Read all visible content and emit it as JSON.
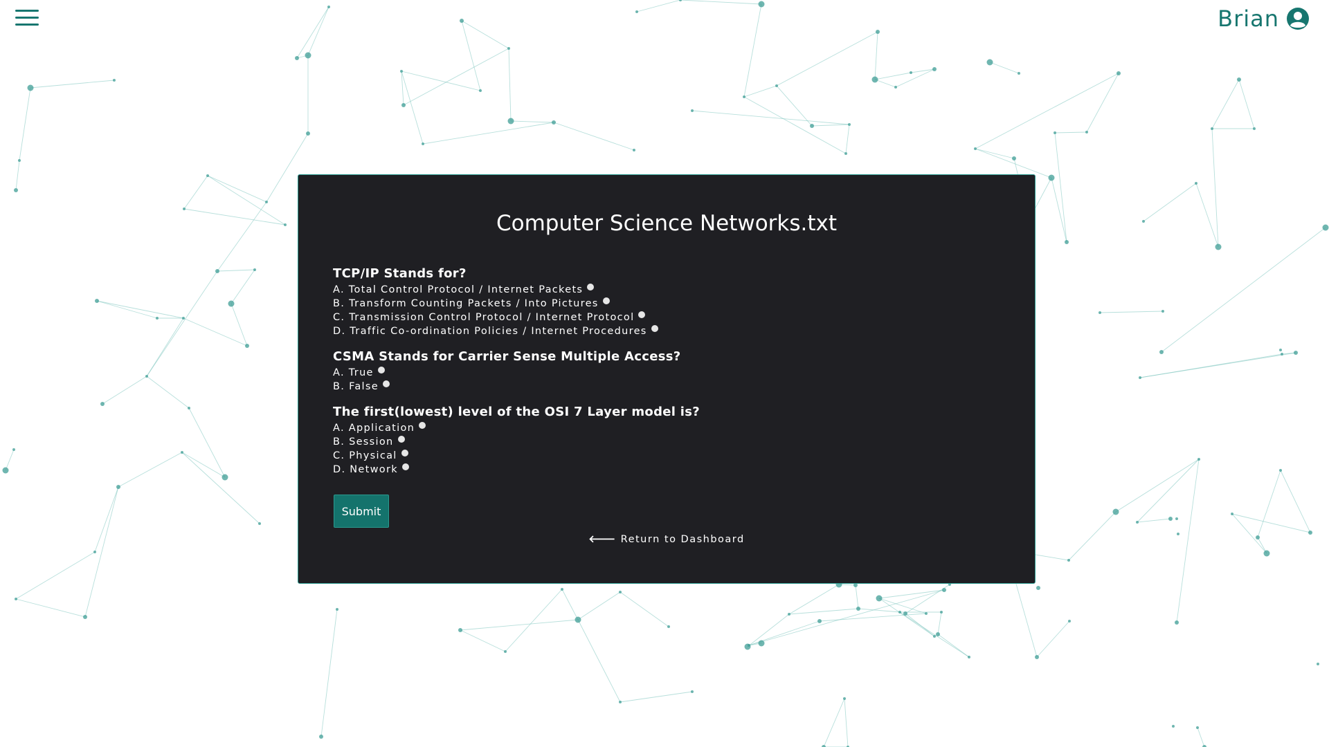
{
  "header": {
    "menu_icon": "hamburger-menu-icon",
    "user_name": "Brian",
    "user_icon": "user-circle-icon",
    "accent_color": "#17766f"
  },
  "quiz": {
    "title": "Computer Science Networks.txt",
    "questions": [
      {
        "text": "TCP/IP Stands for?",
        "options": [
          "A. Total Control Protocol / Internet Packets",
          "B. Transform Counting Packets / Into Pictures",
          "C. Transmission Control Protocol / Internet Protocol",
          "D. Traffic Co-ordination Policies / Internet Procedures"
        ]
      },
      {
        "text": "CSMA Stands for Carrier Sense Multiple Access?",
        "options": [
          "A. True",
          "B. False"
        ]
      },
      {
        "text": "The first(lowest) level of the OSI 7 Layer model is?",
        "options": [
          "A. Application",
          "B. Session",
          "C. Physical",
          "D. Network"
        ]
      }
    ],
    "submit_label": "Submit",
    "return_label": "Return to Dashboard",
    "return_icon": "arrow-left-icon"
  },
  "colors": {
    "card_bg": "#1f1f23",
    "card_border": "#2a9a8f",
    "button_bg": "#14736c",
    "network_line": "#7cc4bd",
    "network_node": "#3f9d95"
  }
}
